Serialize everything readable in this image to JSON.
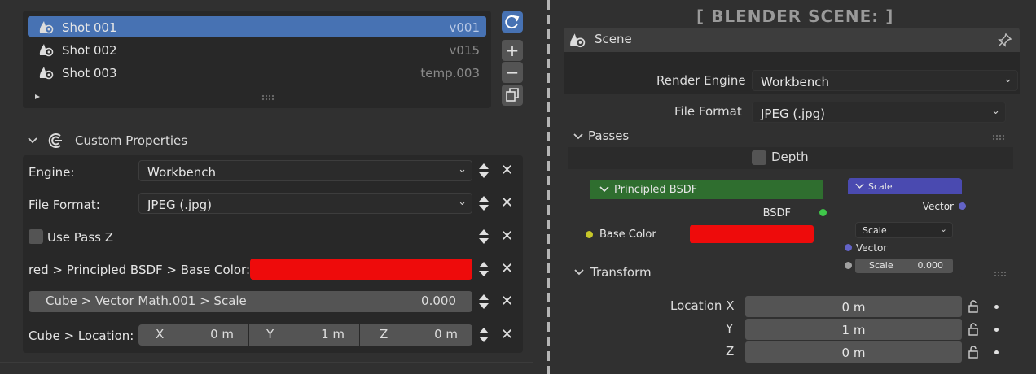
{
  "shot_list": {
    "items": [
      {
        "name": "Shot 001",
        "version": "v001",
        "active": true
      },
      {
        "name": "Shot 002",
        "version": "v015",
        "active": false
      },
      {
        "name": "Shot 003",
        "version": "temp.003",
        "active": false
      }
    ],
    "expand_icon": "play-triangle-icon",
    "grip_icon": "drag-grip-icon"
  },
  "side_buttons": {
    "refresh": "refresh-icon",
    "add": "+",
    "remove": "−",
    "duplicate": "duplicate-icon"
  },
  "custom_properties": {
    "title": "Custom Properties",
    "rows": {
      "engine": {
        "label": "Engine:",
        "value": "Workbench"
      },
      "file_format": {
        "label": "File Format:",
        "value": "JPEG (.jpg)"
      },
      "use_pass_z": {
        "label": "Use Pass Z"
      },
      "base_color": {
        "label": "red > Principled BSDF > Base Color:",
        "color": "#ee0b0b"
      },
      "scale": {
        "label": "Cube > Vector Math.001 > Scale",
        "value": "0.000"
      },
      "location": {
        "label": "Cube > Location:",
        "x_label": "X",
        "x": "0 m",
        "y_label": "Y",
        "y": "1 m",
        "z_label": "Z",
        "z": "0 m"
      }
    }
  },
  "right": {
    "title": "[ BLENDER SCENE: ]",
    "scene": {
      "title": "Scene",
      "render_engine_label": "Render Engine",
      "render_engine": "Workbench",
      "file_format_label": "File Format",
      "file_format": "JPEG (.jpg)"
    },
    "passes": {
      "title": "Passes",
      "depth_label": "Depth"
    },
    "bsdf_node": {
      "title": "Principled BSDF",
      "output": "BSDF",
      "input_label": "Base Color",
      "color": "#ee0b0b"
    },
    "scale_node": {
      "title": "Scale",
      "output": "Vector",
      "select": "Scale",
      "input_vector": "Vector",
      "scale_label": "Scale",
      "scale_value": "0.000"
    },
    "transform": {
      "title": "Transform",
      "loc_x_label": "Location X",
      "loc_x": "0 m",
      "y_label": "Y",
      "y": "1 m",
      "z_label": "Z",
      "z": "0 m"
    }
  },
  "colors": {
    "accent": "#4772b3",
    "bsdf_header": "#2f6e2f",
    "scale_header": "#4a4ab0",
    "socket_yellow": "#c7c729",
    "socket_green": "#3fc74a",
    "socket_purple": "#6363c7",
    "socket_grey": "#a1a1a1"
  }
}
